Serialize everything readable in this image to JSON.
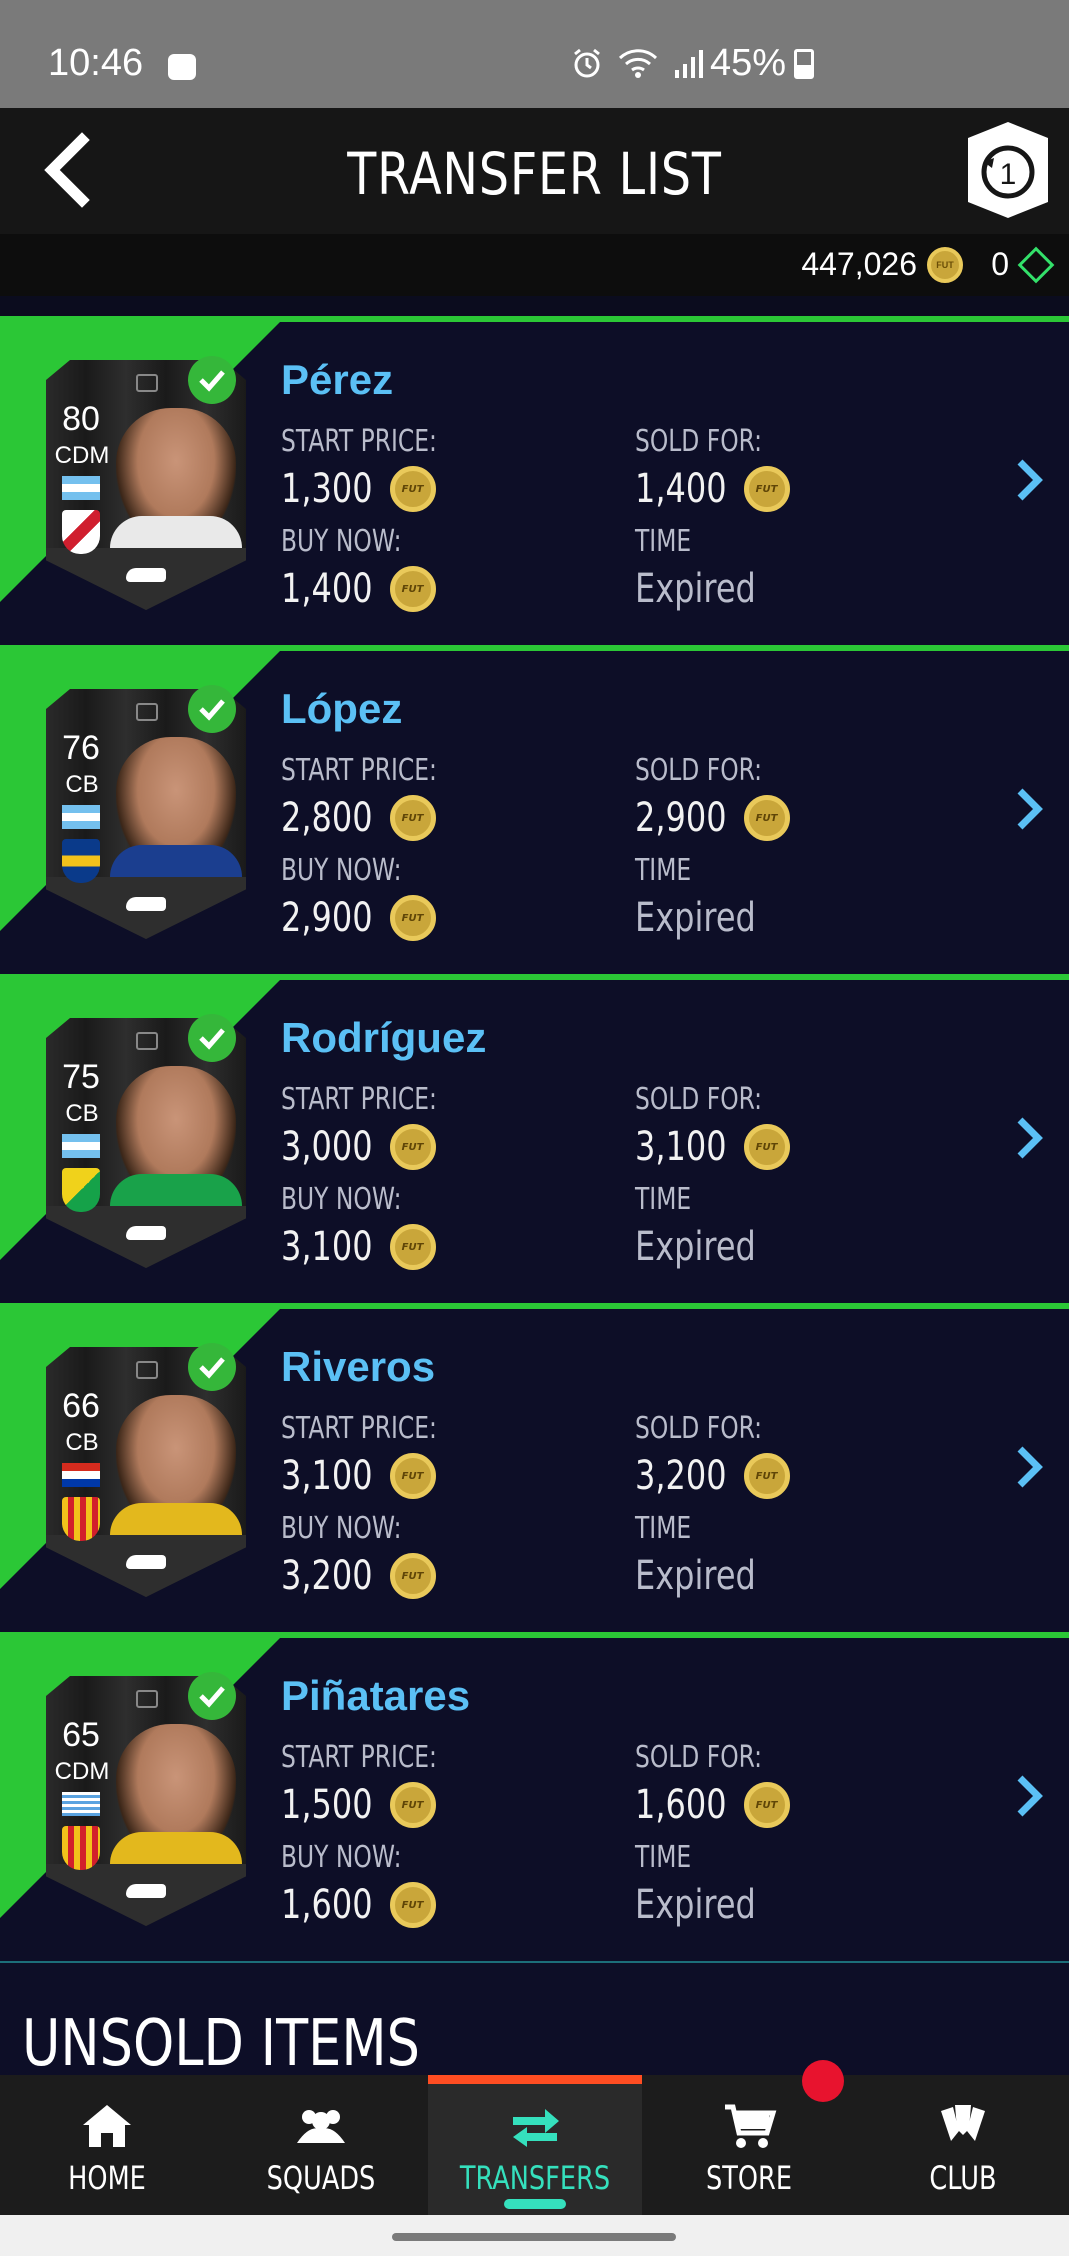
{
  "status_bar": {
    "time": "10:46",
    "battery": "45%"
  },
  "header": {
    "title": "TRANSFER LIST"
  },
  "currency": {
    "coins": "447,026",
    "coin_icon_text": "FUT",
    "points": "0"
  },
  "labels": {
    "start_price": "START PRICE:",
    "buy_now": "BUY NOW:",
    "sold_for": "SOLD FOR:",
    "time": "TIME"
  },
  "items": [
    {
      "name": "Pérez",
      "rating": "80",
      "position": "CDM",
      "start_price": "1,300",
      "buy_now": "1,400",
      "sold_for": "1,400",
      "time": "Expired",
      "flag": "argentina",
      "club": "river-plate",
      "shirt_color": "#e9e9e9"
    },
    {
      "name": "López",
      "rating": "76",
      "position": "CB",
      "start_price": "2,800",
      "buy_now": "2,900",
      "sold_for": "2,900",
      "time": "Expired",
      "flag": "argentina",
      "club": "boca-juniors",
      "shirt_color": "#1b3e8f"
    },
    {
      "name": "Rodríguez",
      "rating": "75",
      "position": "CB",
      "start_price": "3,000",
      "buy_now": "3,100",
      "sold_for": "3,100",
      "time": "Expired",
      "flag": "argentina",
      "club": "defensa-y-justicia",
      "shirt_color": "#19a24a"
    },
    {
      "name": "Riveros",
      "rating": "66",
      "position": "CB",
      "start_price": "3,100",
      "buy_now": "3,200",
      "sold_for": "3,200",
      "time": "Expired",
      "flag": "paraguay",
      "club": "barcelona-sc",
      "shirt_color": "#e3b81d"
    },
    {
      "name": "Piñatares",
      "rating": "65",
      "position": "CDM",
      "start_price": "1,500",
      "buy_now": "1,600",
      "sold_for": "1,600",
      "time": "Expired",
      "flag": "uruguay",
      "club": "barcelona-sc",
      "shirt_color": "#e3b81d"
    }
  ],
  "section": {
    "title": "UNSOLD ITEMS"
  },
  "tabs": [
    {
      "label": "HOME",
      "icon": "home-icon"
    },
    {
      "label": "SQUADS",
      "icon": "squads-icon"
    },
    {
      "label": "TRANSFERS",
      "icon": "transfers-icon",
      "active": true
    },
    {
      "label": "STORE",
      "icon": "cart-icon"
    },
    {
      "label": "CLUB",
      "icon": "club-icon"
    }
  ],
  "colors": {
    "accent_green": "#2bc736",
    "name_blue": "#5bc0f5",
    "active_tab": "#35e0bd",
    "tab_indicator": "#ff4d22",
    "badge_red": "#e8132e"
  }
}
